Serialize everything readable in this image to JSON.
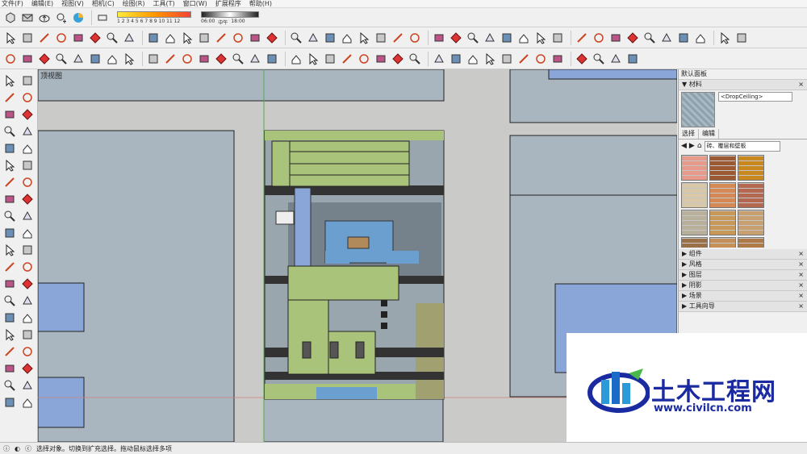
{
  "menu": [
    "文件(F)",
    "编辑(E)",
    "视图(V)",
    "相机(C)",
    "绘图(R)",
    "工具(T)",
    "窗口(W)",
    "扩展程序",
    "帮助(H)"
  ],
  "sun_panel": {
    "months": "1 2 3 4 5 6 7 8 9 10 11 12",
    "time_start": "06:00",
    "time_mid": "中午",
    "time_end": "18:00"
  },
  "viewport": {
    "label": "顶视图"
  },
  "right_panel": {
    "title": "默认面板",
    "materials_header": "材料",
    "material_name": "<DropCeiling>",
    "tab_select": "选择",
    "tab_edit": "编辑",
    "library": "砖、覆层和壁板",
    "sections": [
      "组件",
      "风格",
      "图层",
      "阴影",
      "场景",
      "工具向导"
    ]
  },
  "swatch_colors": [
    "#e89a8a",
    "#9c5a32",
    "#c8881e",
    "#d8c8a8",
    "#d58a55",
    "#b56850",
    "#b8b09a",
    "#c89858",
    "#c8a070",
    "#9a7048",
    "#c49058",
    "#b07a48"
  ],
  "status": {
    "text": "选择对象。切换到扩充选择。拖动鼠标选择多项"
  },
  "watermark": {
    "brand": "土木工程网",
    "url": "www.civilcn.com"
  },
  "colors": {
    "accent": "#1a2aa0",
    "building_blue": "#8aa6d8",
    "roof_green": "#a9c47a",
    "block_gray": "#a9b5bf"
  }
}
